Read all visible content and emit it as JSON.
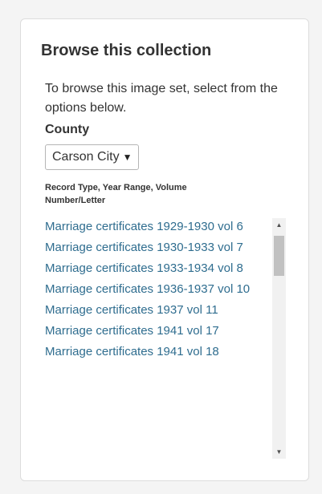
{
  "panel": {
    "title": "Browse this collection",
    "intro": "To browse this image set, select from the options below.",
    "county_label": "County",
    "county_selected": "Carson City",
    "record_label": "Record Type, Year Range, Volume Number/Letter",
    "items": [
      "Marriage certificates 1929-1930 vol 6",
      "Marriage certificates 1930-1933 vol 7",
      "Marriage certificates 1933-1934 vol 8",
      "Marriage certificates 1936-1937 vol 10",
      "Marriage certificates 1937 vol 11",
      "Marriage certificates 1941 vol 17",
      "Marriage certificates 1941 vol 18"
    ]
  },
  "icons": {
    "dropdown": "caret-down-icon",
    "scroll_up": "scroll-up-arrow-icon",
    "scroll_down": "scroll-down-arrow-icon"
  },
  "colors": {
    "link": "#2f6d8f",
    "text": "#333333",
    "card_border": "#dcdcdc",
    "background": "#f4f4f4"
  }
}
